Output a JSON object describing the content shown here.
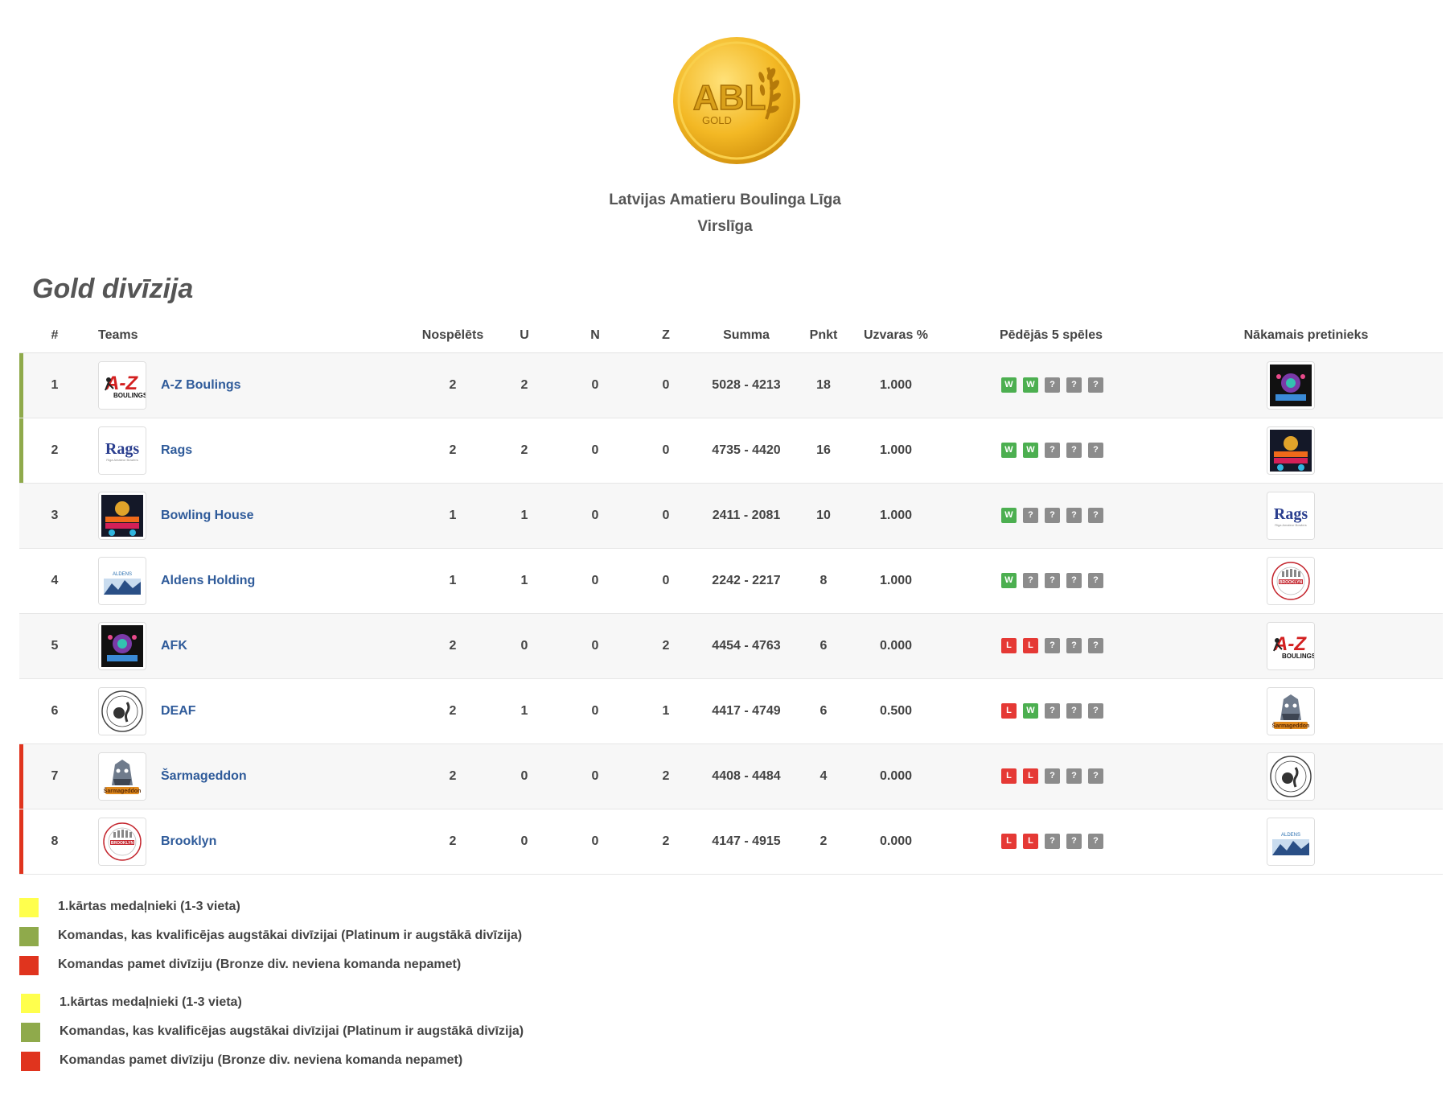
{
  "header": {
    "logo_text": "ABL",
    "logo_sub": "GOLD",
    "league_name": "Latvijas Amatieru Boulinga Līga",
    "league_sub": "Virslīga"
  },
  "division_title": "Gold divīzija",
  "table": {
    "headers": {
      "rank": "#",
      "teams": "Teams",
      "played": "Nospēlēts",
      "u": "U",
      "n": "N",
      "z": "Z",
      "summa": "Summa",
      "pnkt": "Pnkt",
      "uzvaras": "Uzvaras %",
      "last5": "Pēdējās 5 spēles",
      "next": "Nākamais pretinieks"
    },
    "rows": [
      {
        "rank": "1",
        "team": "A-Z Boulings",
        "played": "2",
        "u": "2",
        "n": "0",
        "z": "0",
        "summa": "5028 - 4213",
        "pnkt": "18",
        "pct": "1.000",
        "form": [
          "W",
          "W",
          "?",
          "?",
          "?"
        ],
        "status": "promote",
        "logo": "az",
        "next": "afk"
      },
      {
        "rank": "2",
        "team": "Rags",
        "played": "2",
        "u": "2",
        "n": "0",
        "z": "0",
        "summa": "4735 - 4420",
        "pnkt": "16",
        "pct": "1.000",
        "form": [
          "W",
          "W",
          "?",
          "?",
          "?"
        ],
        "status": "promote",
        "logo": "rags",
        "next": "bowling"
      },
      {
        "rank": "3",
        "team": "Bowling House",
        "played": "1",
        "u": "1",
        "n": "0",
        "z": "0",
        "summa": "2411 - 2081",
        "pnkt": "10",
        "pct": "1.000",
        "form": [
          "W",
          "?",
          "?",
          "?",
          "?"
        ],
        "status": "none",
        "logo": "bowling",
        "next": "rags"
      },
      {
        "rank": "4",
        "team": "Aldens Holding",
        "played": "1",
        "u": "1",
        "n": "0",
        "z": "0",
        "summa": "2242 - 2217",
        "pnkt": "8",
        "pct": "1.000",
        "form": [
          "W",
          "?",
          "?",
          "?",
          "?"
        ],
        "status": "none",
        "logo": "aldens",
        "next": "brooklyn"
      },
      {
        "rank": "5",
        "team": "AFK",
        "played": "2",
        "u": "0",
        "n": "0",
        "z": "2",
        "summa": "4454 - 4763",
        "pnkt": "6",
        "pct": "0.000",
        "form": [
          "L",
          "L",
          "?",
          "?",
          "?"
        ],
        "status": "none",
        "logo": "afk",
        "next": "az"
      },
      {
        "rank": "6",
        "team": "DEAF",
        "played": "2",
        "u": "1",
        "n": "0",
        "z": "1",
        "summa": "4417 - 4749",
        "pnkt": "6",
        "pct": "0.500",
        "form": [
          "L",
          "W",
          "?",
          "?",
          "?"
        ],
        "status": "none",
        "logo": "deaf",
        "next": "sarm"
      },
      {
        "rank": "7",
        "team": "Šarmageddon",
        "played": "2",
        "u": "0",
        "n": "0",
        "z": "2",
        "summa": "4408 - 4484",
        "pnkt": "4",
        "pct": "0.000",
        "form": [
          "L",
          "L",
          "?",
          "?",
          "?"
        ],
        "status": "relegate",
        "logo": "sarm",
        "next": "deaf"
      },
      {
        "rank": "8",
        "team": "Brooklyn",
        "played": "2",
        "u": "0",
        "n": "0",
        "z": "2",
        "summa": "4147 - 4915",
        "pnkt": "2",
        "pct": "0.000",
        "form": [
          "L",
          "L",
          "?",
          "?",
          "?"
        ],
        "status": "relegate",
        "logo": "brooklyn",
        "next": "aldens"
      }
    ]
  },
  "legend_1": [
    {
      "label": "1.kārtas medaļnieki (1-3 vieta)",
      "color": "#ffff4d"
    },
    {
      "label": "Komandas, kas kvalificējas augstākai divīzijai (Platinum ir augstākā divīzija)",
      "color": "#8faa4b"
    },
    {
      "label": "Komandas pamet divīziju (Bronze div. neviena komanda nepamet)",
      "color": "#e0341e"
    }
  ],
  "legend_2": [
    {
      "label": "1.kārtas medaļnieki (1-3 vieta)",
      "color": "#ffff4d"
    },
    {
      "label": "Komandas, kas kvalificējas augstākai divīzijai (Platinum ir augstākā divīzija)",
      "color": "#8faa4b"
    },
    {
      "label": "Komandas pamet divīziju (Bronze div. neviena komanda nepamet)",
      "color": "#e0341e"
    }
  ],
  "colors": {
    "promote": "#8faa4b",
    "relegate": "#e0341e",
    "win": "#4caf50",
    "loss": "#e53935",
    "unknown": "#8c8c8c",
    "team_link": "#2f5b9a"
  }
}
